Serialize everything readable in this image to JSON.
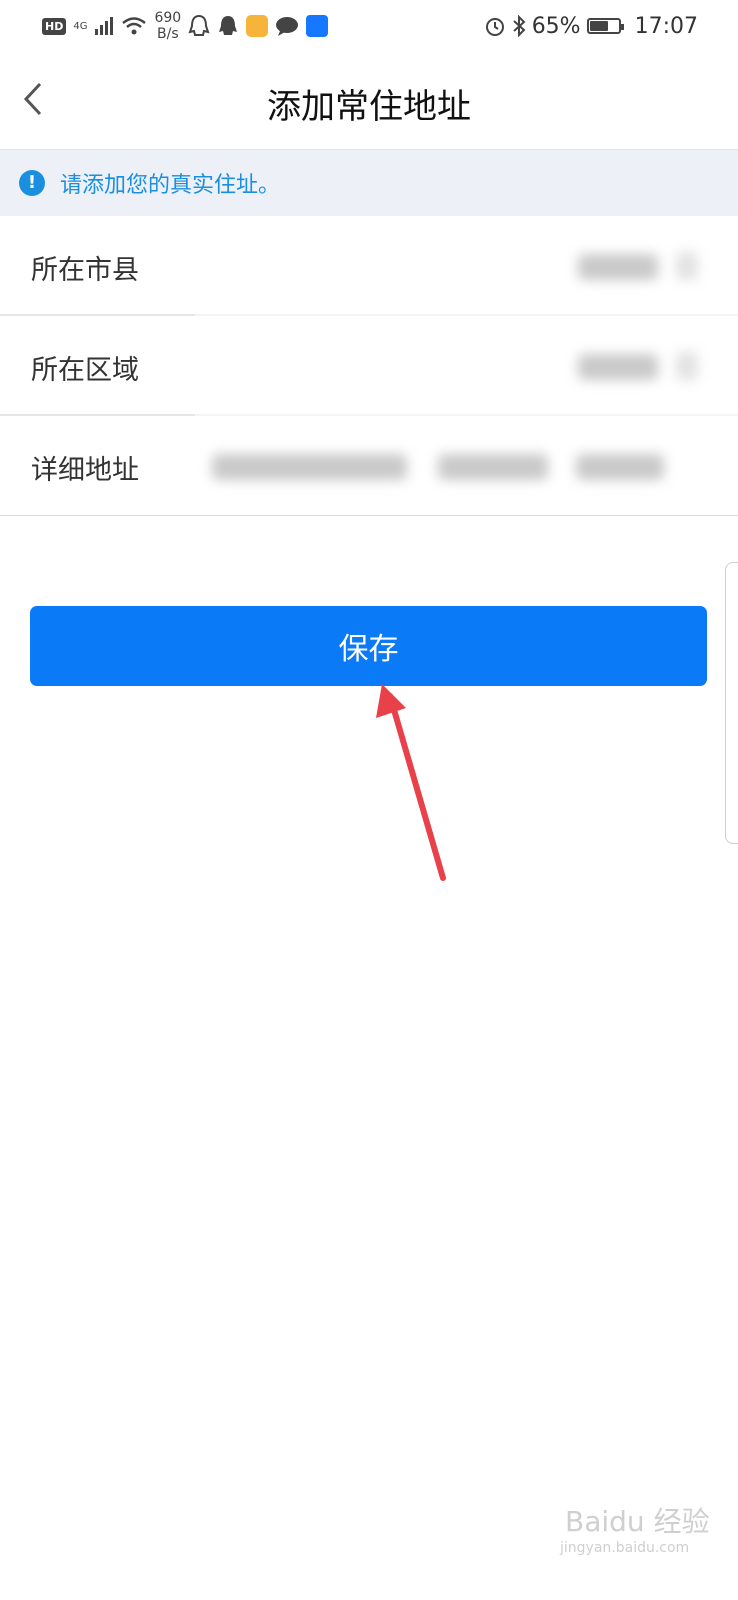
{
  "status_bar": {
    "hd": "HD",
    "network": "4G",
    "speed_value": "690",
    "speed_unit": "B/s",
    "battery": "65%",
    "battery_level": 0.65,
    "time": "17:07"
  },
  "header": {
    "title": "添加常住地址"
  },
  "notice": {
    "text": "请添加您的真实住址。"
  },
  "form": {
    "rows": [
      {
        "label": "所在市县"
      },
      {
        "label": "所在区域"
      },
      {
        "label": "详细地址"
      }
    ]
  },
  "actions": {
    "save_label": "保存"
  },
  "colors": {
    "primary": "#0a7af7",
    "notice_text": "#1a8fe0",
    "notice_bg": "#edf1f7",
    "arrow": "#e8414a"
  }
}
